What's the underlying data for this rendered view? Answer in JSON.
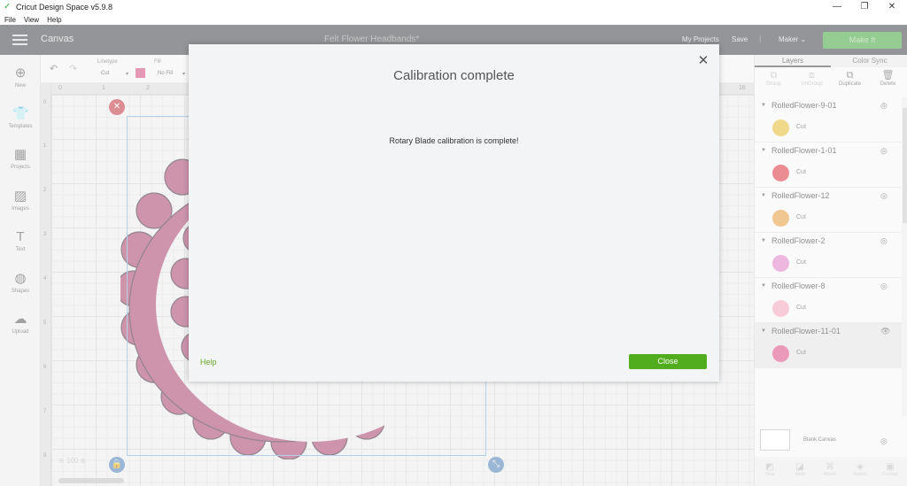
{
  "window": {
    "title": "Cricut Design Space  v5.9.8",
    "menu": [
      "File",
      "View",
      "Help"
    ],
    "controls": {
      "minimize": "—",
      "maximize": "❐",
      "close": "✕"
    }
  },
  "header": {
    "section": "Canvas",
    "project_title": "Felt Flower Headbands*",
    "my_projects": "My Projects",
    "save": "Save",
    "separator": "|",
    "machine": "Maker",
    "machine_caret": "⌄",
    "make_it": "Make It"
  },
  "left_tools": [
    {
      "label": "New",
      "icon": "plus-circle-icon"
    },
    {
      "label": "Templates",
      "icon": "shirt-icon"
    },
    {
      "label": "Projects",
      "icon": "projects-icon"
    },
    {
      "label": "Images",
      "icon": "images-icon"
    },
    {
      "label": "Text",
      "icon": "text-icon"
    },
    {
      "label": "Shapes",
      "icon": "shapes-icon"
    },
    {
      "label": "Upload",
      "icon": "upload-icon"
    }
  ],
  "edit_toolbar": {
    "linetype_label": "Linetype",
    "linetype_value": "Cut",
    "fill_label": "Fill",
    "fill_value": "No Fill",
    "swatch_color": "#d24377"
  },
  "rulers": {
    "top": [
      "0",
      "1",
      "2",
      "16"
    ],
    "left": [
      "0",
      "1",
      "2",
      "3",
      "4",
      "5",
      "6",
      "7",
      "8"
    ]
  },
  "canvas": {
    "shape_color": "#a43c68",
    "zoom": "100"
  },
  "right_panel": {
    "tabs": [
      "Layers",
      "Color Sync"
    ],
    "actions": [
      {
        "label": "Group",
        "enabled": false
      },
      {
        "label": "UnGroup",
        "enabled": false
      },
      {
        "label": "Duplicate",
        "enabled": true
      },
      {
        "label": "Delete",
        "enabled": true
      }
    ],
    "layers": [
      {
        "name": "RolledFlower-9-01",
        "op": "Cut",
        "color": "#e3bb2a",
        "selected": false
      },
      {
        "name": "RolledFlower-1-01",
        "op": "Cut",
        "color": "#d92f3a",
        "selected": false
      },
      {
        "name": "RolledFlower-12",
        "op": "Cut",
        "color": "#e59a37",
        "selected": false
      },
      {
        "name": "RolledFlower-2",
        "op": "Cut",
        "color": "#e07cc5",
        "selected": false
      },
      {
        "name": "RolledFlower-8",
        "op": "Cut",
        "color": "#f0a3b8",
        "selected": false
      },
      {
        "name": "RolledFlower-11-01",
        "op": "Cut",
        "color": "#d9487f",
        "selected": true
      }
    ],
    "blank_canvas": "Blank Canvas",
    "bottom_actions": [
      "Slice",
      "Weld",
      "Attach",
      "Flatten",
      "Contour"
    ]
  },
  "modal": {
    "title": "Calibration complete",
    "message": "Rotary Blade calibration is complete!",
    "help": "Help",
    "close_button": "Close"
  }
}
